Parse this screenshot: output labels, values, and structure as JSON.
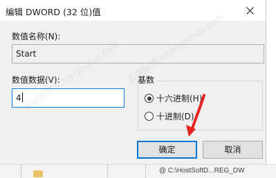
{
  "dialog": {
    "title": "编辑 DWORD (32 位)值",
    "close_icon": "close-icon",
    "value_name_label": "数值名称(N):",
    "value_name": "Start",
    "value_data_label": "数值数据(V):",
    "value_data": "4",
    "base_group_label": "基数",
    "radio_hex_label": "十六进制(H)",
    "radio_dec_label": "十进制(D)",
    "selected_base": "hex",
    "ok_label": "确定",
    "cancel_label": "取消"
  },
  "background": {
    "bottom_text": "@ C:\\HostSoftD...REG_DW"
  },
  "watermark": {
    "text": "系统部落 xitongbuluo.com"
  },
  "colors": {
    "focus_blue": "#0078d7",
    "arrow_red": "#e8221e"
  }
}
